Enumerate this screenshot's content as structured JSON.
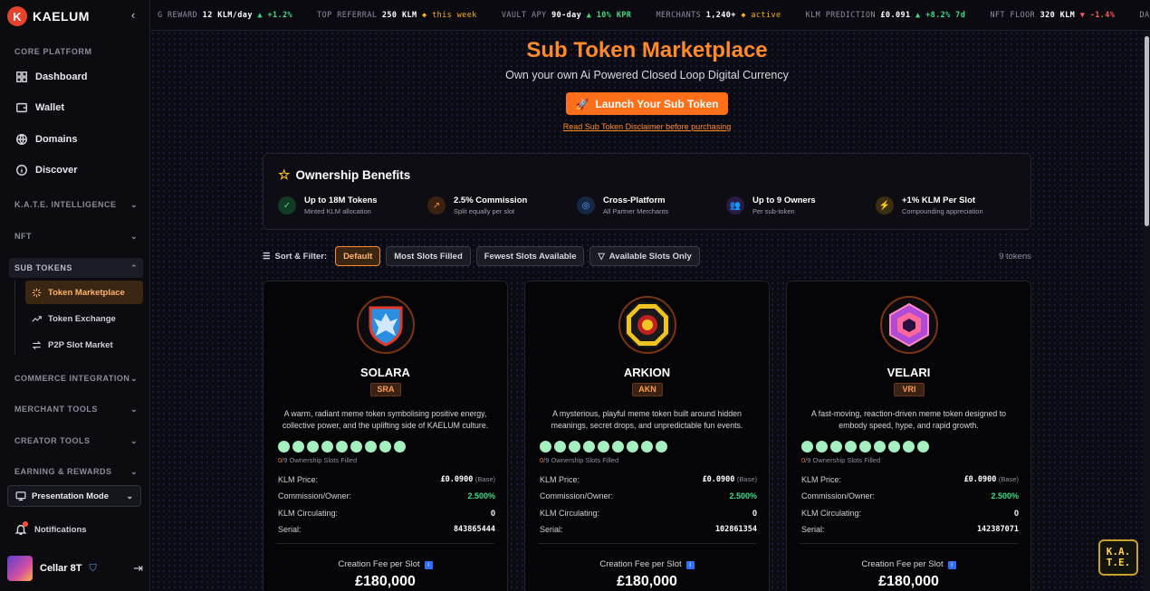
{
  "brand": {
    "name": "KAELUM",
    "mark": "K"
  },
  "sidebar": {
    "core_label": "CORE PLATFORM",
    "core_items": [
      {
        "label": "Dashboard",
        "icon": "grid-icon"
      },
      {
        "label": "Wallet",
        "icon": "wallet-icon"
      },
      {
        "label": "Domains",
        "icon": "globe-icon"
      },
      {
        "label": "Discover",
        "icon": "info-circle-icon"
      }
    ],
    "groups": [
      {
        "label": "K.A.T.E. INTELLIGENCE"
      },
      {
        "label": "NFT"
      },
      {
        "label": "SUB TOKENS"
      },
      {
        "label": "COMMERCE INTEGRATION"
      },
      {
        "label": "MERCHANT TOOLS"
      },
      {
        "label": "CREATOR TOOLS"
      },
      {
        "label": "EARNING & REWARDS"
      }
    ],
    "sub_items": [
      {
        "label": "Token Marketplace",
        "icon": "sparkle-icon"
      },
      {
        "label": "Token Exchange",
        "icon": "trend-icon"
      },
      {
        "label": "P2P Slot Market",
        "icon": "swap-icon"
      }
    ],
    "presentation": "Presentation Mode",
    "notifications": "Notifications",
    "user_name": "Cellar 8T"
  },
  "ticker": [
    {
      "label": "G REWARD",
      "value": "12 KLM/day",
      "delta": "▲ +1.2%",
      "dir": "up"
    },
    {
      "label": "TOP REFERRAL",
      "value": "250 KLM",
      "delta": "◆ this week",
      "dir": "diamond"
    },
    {
      "label": "VAULT APY",
      "value": "90-day",
      "delta": "▲ 10% KPR",
      "dir": "up"
    },
    {
      "label": "MERCHANTS",
      "value": "1,240+",
      "delta": "◆ active",
      "dir": "diamond"
    },
    {
      "label": "KLM PREDICTION",
      "value": "£0.091",
      "delta": "▲ +8.2% 7d",
      "dir": "up"
    },
    {
      "label": "NFT FLOOR",
      "value": "320 KLM",
      "delta": "▼ -1.4%",
      "dir": "dn"
    },
    {
      "label": "DAILY VOLUME",
      "value": "",
      "delta": "",
      "dir": "up"
    }
  ],
  "hero": {
    "title": "Sub Token Marketplace",
    "subtitle": "Own your own Ai Powered Closed Loop Digital Currency",
    "launch_label": "Launch Your Sub Token",
    "disclaimer": "Read Sub Token Disclaimer before purchasing"
  },
  "benefits": {
    "title": "Ownership Benefits",
    "items": [
      {
        "title": "Up to 18M Tokens",
        "sub": "Minted KLM allocation",
        "icon": "check-icon",
        "color": "#3ddc84",
        "bg": "#123a24"
      },
      {
        "title": "2.5% Commission",
        "sub": "Split equally per slot",
        "icon": "trend-icon",
        "color": "#ff8a2a",
        "bg": "#3a2213"
      },
      {
        "title": "Cross-Platform",
        "sub": "All Partner Merchants",
        "icon": "globe-icon",
        "color": "#5aa0ff",
        "bg": "#142846"
      },
      {
        "title": "Up to 9 Owners",
        "sub": "Per sub-token",
        "icon": "users-icon",
        "color": "#b27cff",
        "bg": "#2a1a44"
      },
      {
        "title": "+1% KLM Per Slot",
        "sub": "Compounding appreciation",
        "icon": "bolt-icon",
        "color": "#ffc21a",
        "bg": "#3a3010"
      }
    ]
  },
  "sort": {
    "label": "Sort & Filter:",
    "options": [
      "Default",
      "Most Slots Filled",
      "Fewest Slots Available",
      "Available Slots Only"
    ],
    "count": "9 tokens"
  },
  "card_labels": {
    "slots_filled": "0",
    "slots_total": "/9 Ownership Slots Filled",
    "price": "KLM Price:",
    "commission": "Commission/Owner:",
    "circulating": "KLM Circulating:",
    "serial": "Serial:",
    "base": "(Base)",
    "fee_label": "Creation Fee per Slot",
    "info": "i"
  },
  "tokens": [
    {
      "name": "SOLARA",
      "symbol": "SRA",
      "desc": "A warm, radiant meme token symbolising positive energy, collective power, and the uplifting side of KAELUM culture.",
      "price": "£0.0900",
      "commission": "2.500%",
      "circulating": "0",
      "serial": "843865444",
      "fee": "£180,000",
      "slots_filled": 0,
      "slots_total": 9,
      "emblem": "phoenix-shield-icon"
    },
    {
      "name": "ARKION",
      "symbol": "AKN",
      "desc": "A mysterious, playful meme token built around hidden meanings, secret drops, and unpredictable fun events.",
      "price": "£0.0900",
      "commission": "2.500%",
      "circulating": "0",
      "serial": "102861354",
      "fee": "£180,000",
      "slots_filled": 0,
      "slots_total": 9,
      "emblem": "octagon-seal-icon"
    },
    {
      "name": "VELARI",
      "symbol": "VRI",
      "desc": "A fast-moving, reaction-driven meme token designed to embody speed, hype, and rapid growth.",
      "price": "£0.0900",
      "commission": "2.500%",
      "circulating": "0",
      "serial": "142387071",
      "fee": "£180,000",
      "slots_filled": 0,
      "slots_total": 9,
      "emblem": "neon-hexagon-icon"
    }
  ],
  "assistant_badge": "K.A.T.E.",
  "assistant_lines": [
    "K.A.",
    "T.E."
  ],
  "colors": {
    "accent": "#ff8a2a",
    "slot": "#a4f0bf",
    "positive": "#3ddc84",
    "negative": "#ff5b5b"
  }
}
